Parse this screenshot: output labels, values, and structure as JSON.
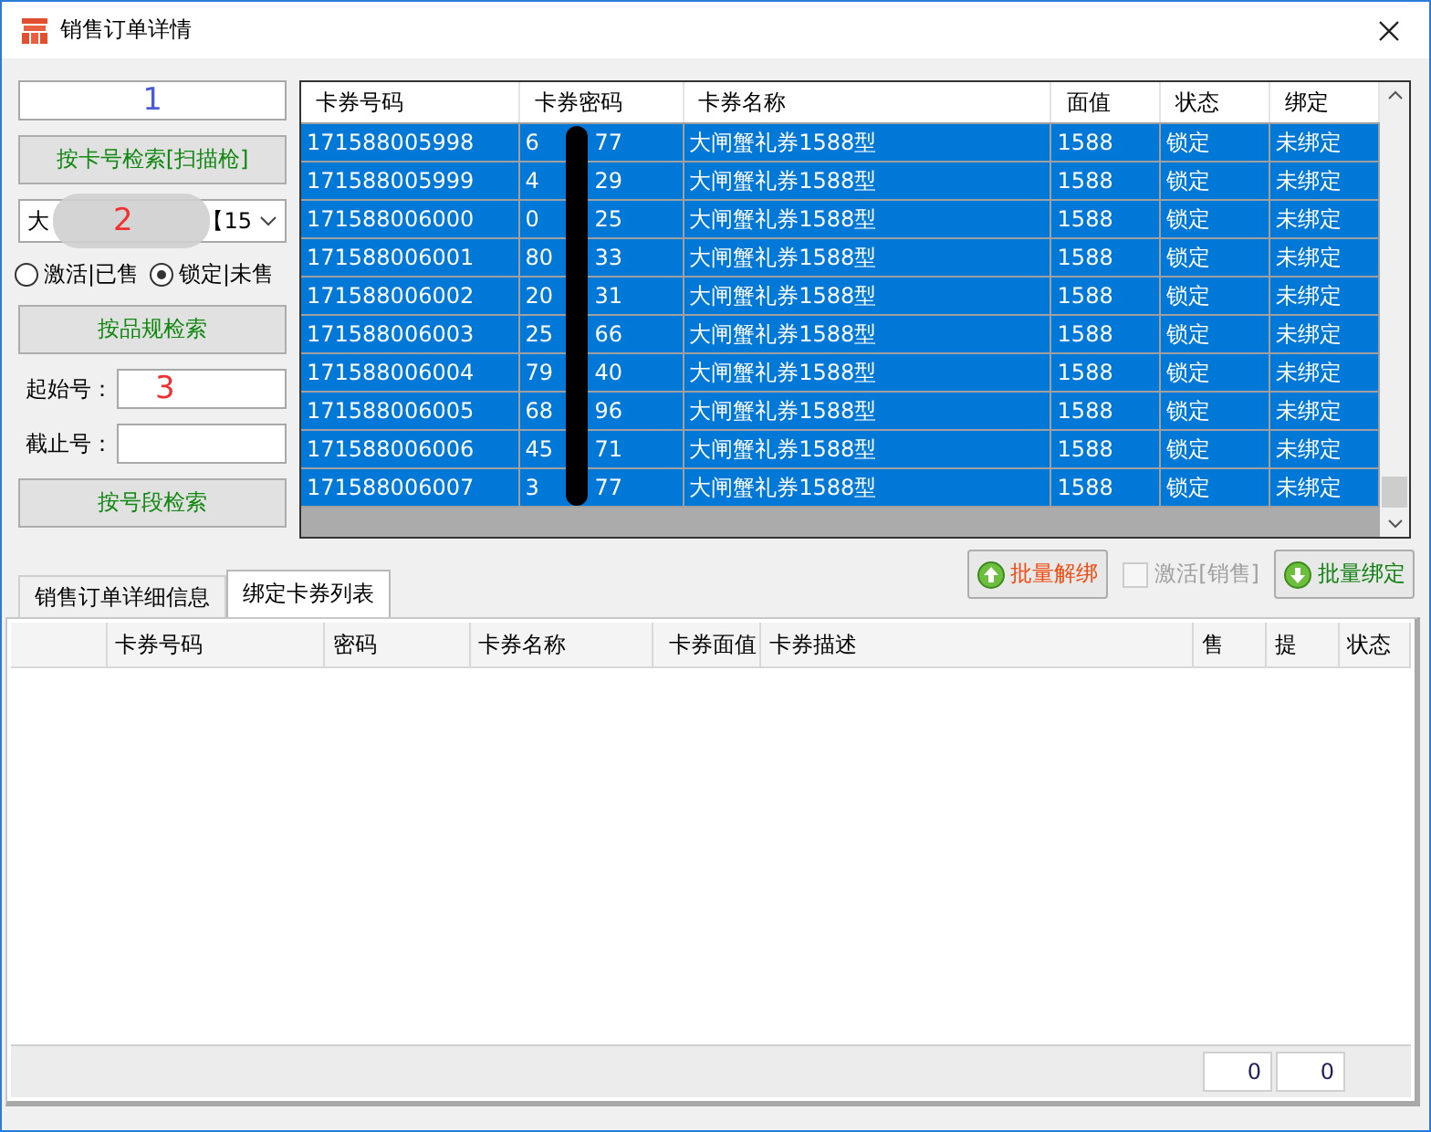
{
  "window": {
    "title": "销售订单详情"
  },
  "left": {
    "card_field": {
      "annotation": "1"
    },
    "card_search_button": "按卡号检索[扫描枪]",
    "spec_dropdown": {
      "value_start": "大",
      "value_end": "【15",
      "annotation": "2"
    },
    "radios": [
      {
        "label": "激活|已售",
        "selected": false
      },
      {
        "label": "锁定|未售",
        "selected": true
      }
    ],
    "spec_search_button": "按品规检索",
    "start_field": {
      "label": "起始号：",
      "annotation": "3"
    },
    "end_field": {
      "label": "截止号："
    },
    "range_search_button": "按号段检索"
  },
  "card_grid": {
    "columns": [
      "卡券号码",
      "卡券密码",
      "卡券名称",
      "面值",
      "状态",
      "绑定"
    ],
    "rows": [
      {
        "number": "171588005998",
        "password_start": "6",
        "password_end": "77",
        "name": "大闸蟹礼券1588型",
        "value": "1588",
        "status": "锁定",
        "binding": "未绑定",
        "selected": true
      },
      {
        "number": "171588005999",
        "password_start": "4",
        "password_end": "29",
        "name": "大闸蟹礼券1588型",
        "value": "1588",
        "status": "锁定",
        "binding": "未绑定",
        "selected": true
      },
      {
        "number": "171588006000",
        "password_start": "0",
        "password_end": "25",
        "name": "大闸蟹礼券1588型",
        "value": "1588",
        "status": "锁定",
        "binding": "未绑定",
        "selected": true
      },
      {
        "number": "171588006001",
        "password_start": "80",
        "password_end": "33",
        "name": "大闸蟹礼券1588型",
        "value": "1588",
        "status": "锁定",
        "binding": "未绑定",
        "selected": true
      },
      {
        "number": "171588006002",
        "password_start": "20",
        "password_end": "31",
        "name": "大闸蟹礼券1588型",
        "value": "1588",
        "status": "锁定",
        "binding": "未绑定",
        "selected": true
      },
      {
        "number": "171588006003",
        "password_start": "25",
        "password_end": "66",
        "name": "大闸蟹礼券1588型",
        "value": "1588",
        "status": "锁定",
        "binding": "未绑定",
        "selected": true
      },
      {
        "number": "171588006004",
        "password_start": "79",
        "password_end": "40",
        "name": "大闸蟹礼券1588型",
        "value": "1588",
        "status": "锁定",
        "binding": "未绑定",
        "selected": true
      },
      {
        "number": "171588006005",
        "password_start": "68",
        "password_end": "96",
        "name": "大闸蟹礼券1588型",
        "value": "1588",
        "status": "锁定",
        "binding": "未绑定",
        "selected": true
      },
      {
        "number": "171588006006",
        "password_start": "45",
        "password_end": "71",
        "name": "大闸蟹礼券1588型",
        "value": "1588",
        "status": "锁定",
        "binding": "未绑定",
        "selected": true
      },
      {
        "number": "171588006007",
        "password_start": "3",
        "password_end": "77",
        "name": "大闸蟹礼券1588型",
        "value": "1588",
        "status": "锁定",
        "binding": "未绑定",
        "selected": true
      }
    ]
  },
  "actions": {
    "unbind_button": "批量解绑",
    "activate_checkbox": {
      "label": "激活[销售]",
      "checked": false,
      "disabled": true
    },
    "bind_button": "批量绑定"
  },
  "tabs": [
    {
      "label": "销售订单详细信息",
      "selected": false
    },
    {
      "label": "绑定卡券列表",
      "selected": true
    }
  ],
  "bound_table": {
    "columns": [
      "卡券号码",
      "密码",
      "卡券名称",
      "卡券面值",
      "卡券描述",
      "售",
      "提",
      "状态"
    ]
  },
  "footer": {
    "counts": [
      "0",
      "0"
    ]
  }
}
